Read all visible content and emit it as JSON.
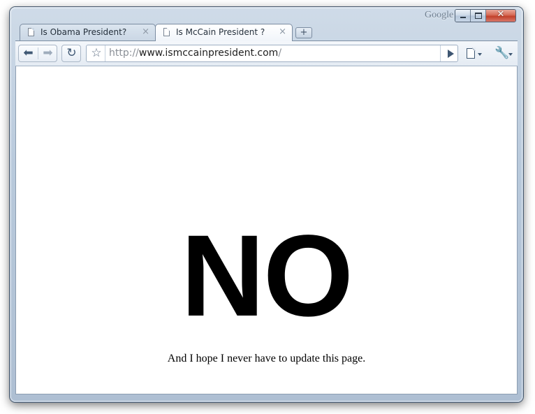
{
  "window": {
    "brand": "Google",
    "caption_close": "✕"
  },
  "tabs": [
    {
      "title": "Is Obama President?",
      "active": false,
      "close": "×"
    },
    {
      "title": "Is McCain President ?",
      "active": true,
      "close": "×"
    }
  ],
  "new_tab_glyph": "+",
  "toolbar": {
    "back_glyph": "⬅",
    "forward_glyph": "➡",
    "reload_glyph": "↻",
    "star_glyph": "☆",
    "wrench_glyph": "🔧"
  },
  "address": {
    "scheme": "http://",
    "host": "www.ismccainpresident.com",
    "path": "/"
  },
  "page": {
    "answer": "NO",
    "note": "And I hope I never have to update this page."
  },
  "icons": {
    "tab_icon": "page-icon",
    "bookmark": "star-icon",
    "go": "go-arrow-icon",
    "page_menu": "page-menu-icon",
    "tools_menu": "wrench-icon"
  }
}
